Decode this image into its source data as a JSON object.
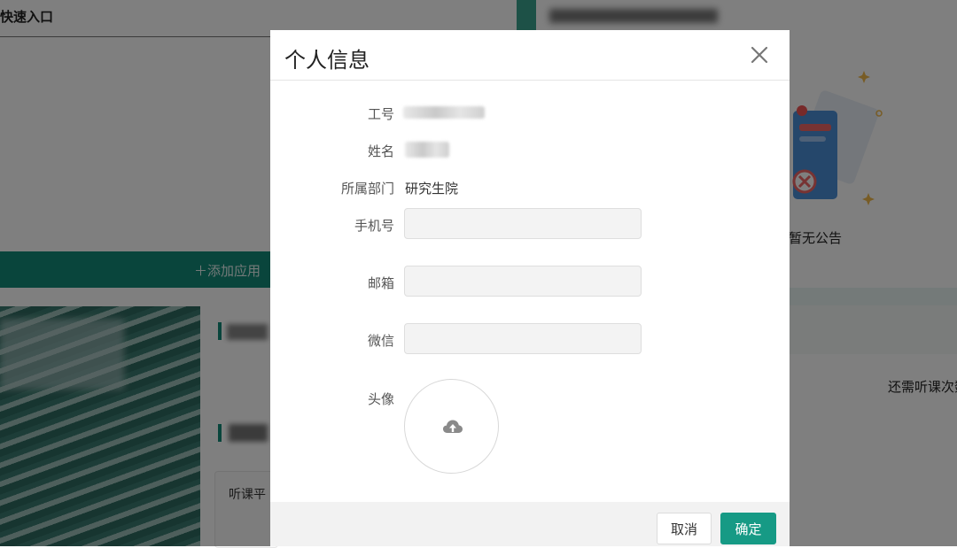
{
  "background": {
    "quick_entry_title": "快速入口",
    "add_app_label": "＋添加应用",
    "listen_card_text": "听课平",
    "no_notice_text": "暂无公告",
    "remaining_text": "还需听课次数",
    "accent_color": "#138a78"
  },
  "dialog": {
    "title": "个人信息",
    "close_icon": "close-icon",
    "fields": {
      "employee_id_label": "工号",
      "name_label": "姓名",
      "department_label": "所属部门",
      "department_value": "研究生院",
      "phone_label": "手机号",
      "phone_value": "",
      "email_label": "邮箱",
      "email_value": "",
      "wechat_label": "微信",
      "wechat_value": "",
      "avatar_label": "头像",
      "avatar_icon": "cloud-upload-icon"
    },
    "footer": {
      "cancel_label": "取消",
      "confirm_label": "确定",
      "confirm_color": "#169a85"
    }
  }
}
